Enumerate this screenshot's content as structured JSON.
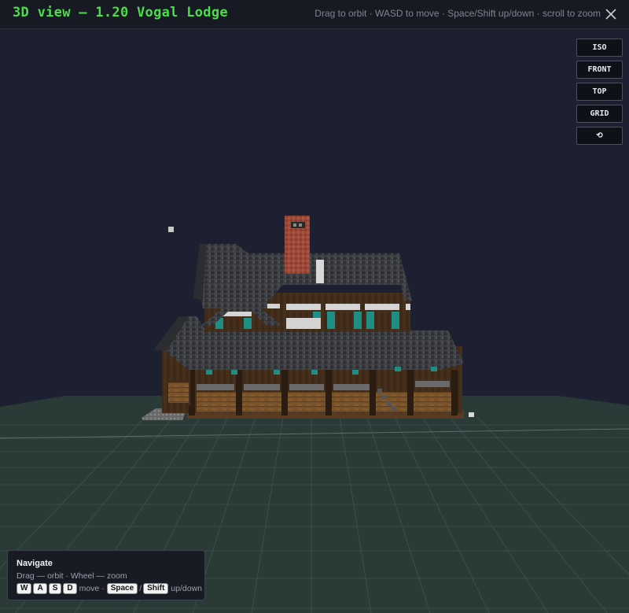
{
  "header": {
    "title": "3D view — 1.20 Vogal Lodge",
    "hint": "Drag to orbit · WASD to move · Space/Shift up/down · scroll to zoom",
    "close_icon": "close-icon"
  },
  "view_buttons": {
    "iso": "ISO",
    "front": "FRONT",
    "top": "TOP",
    "grid": "GRID",
    "reset": "⟲"
  },
  "navigate_panel": {
    "title": "Navigate",
    "line1": "Drag — orbit · Wheel — zoom",
    "keys": {
      "w": "W",
      "a": "A",
      "s": "S",
      "d": "D",
      "move_label": "move ·",
      "space": "Space",
      "slash": "/",
      "shift": "Shift",
      "updown_label": "up/down"
    }
  },
  "colors": {
    "background": "#1d2030",
    "title_green": "#4ade4a",
    "ground": "#2a3a35",
    "grid_line": "#3d5a55"
  }
}
